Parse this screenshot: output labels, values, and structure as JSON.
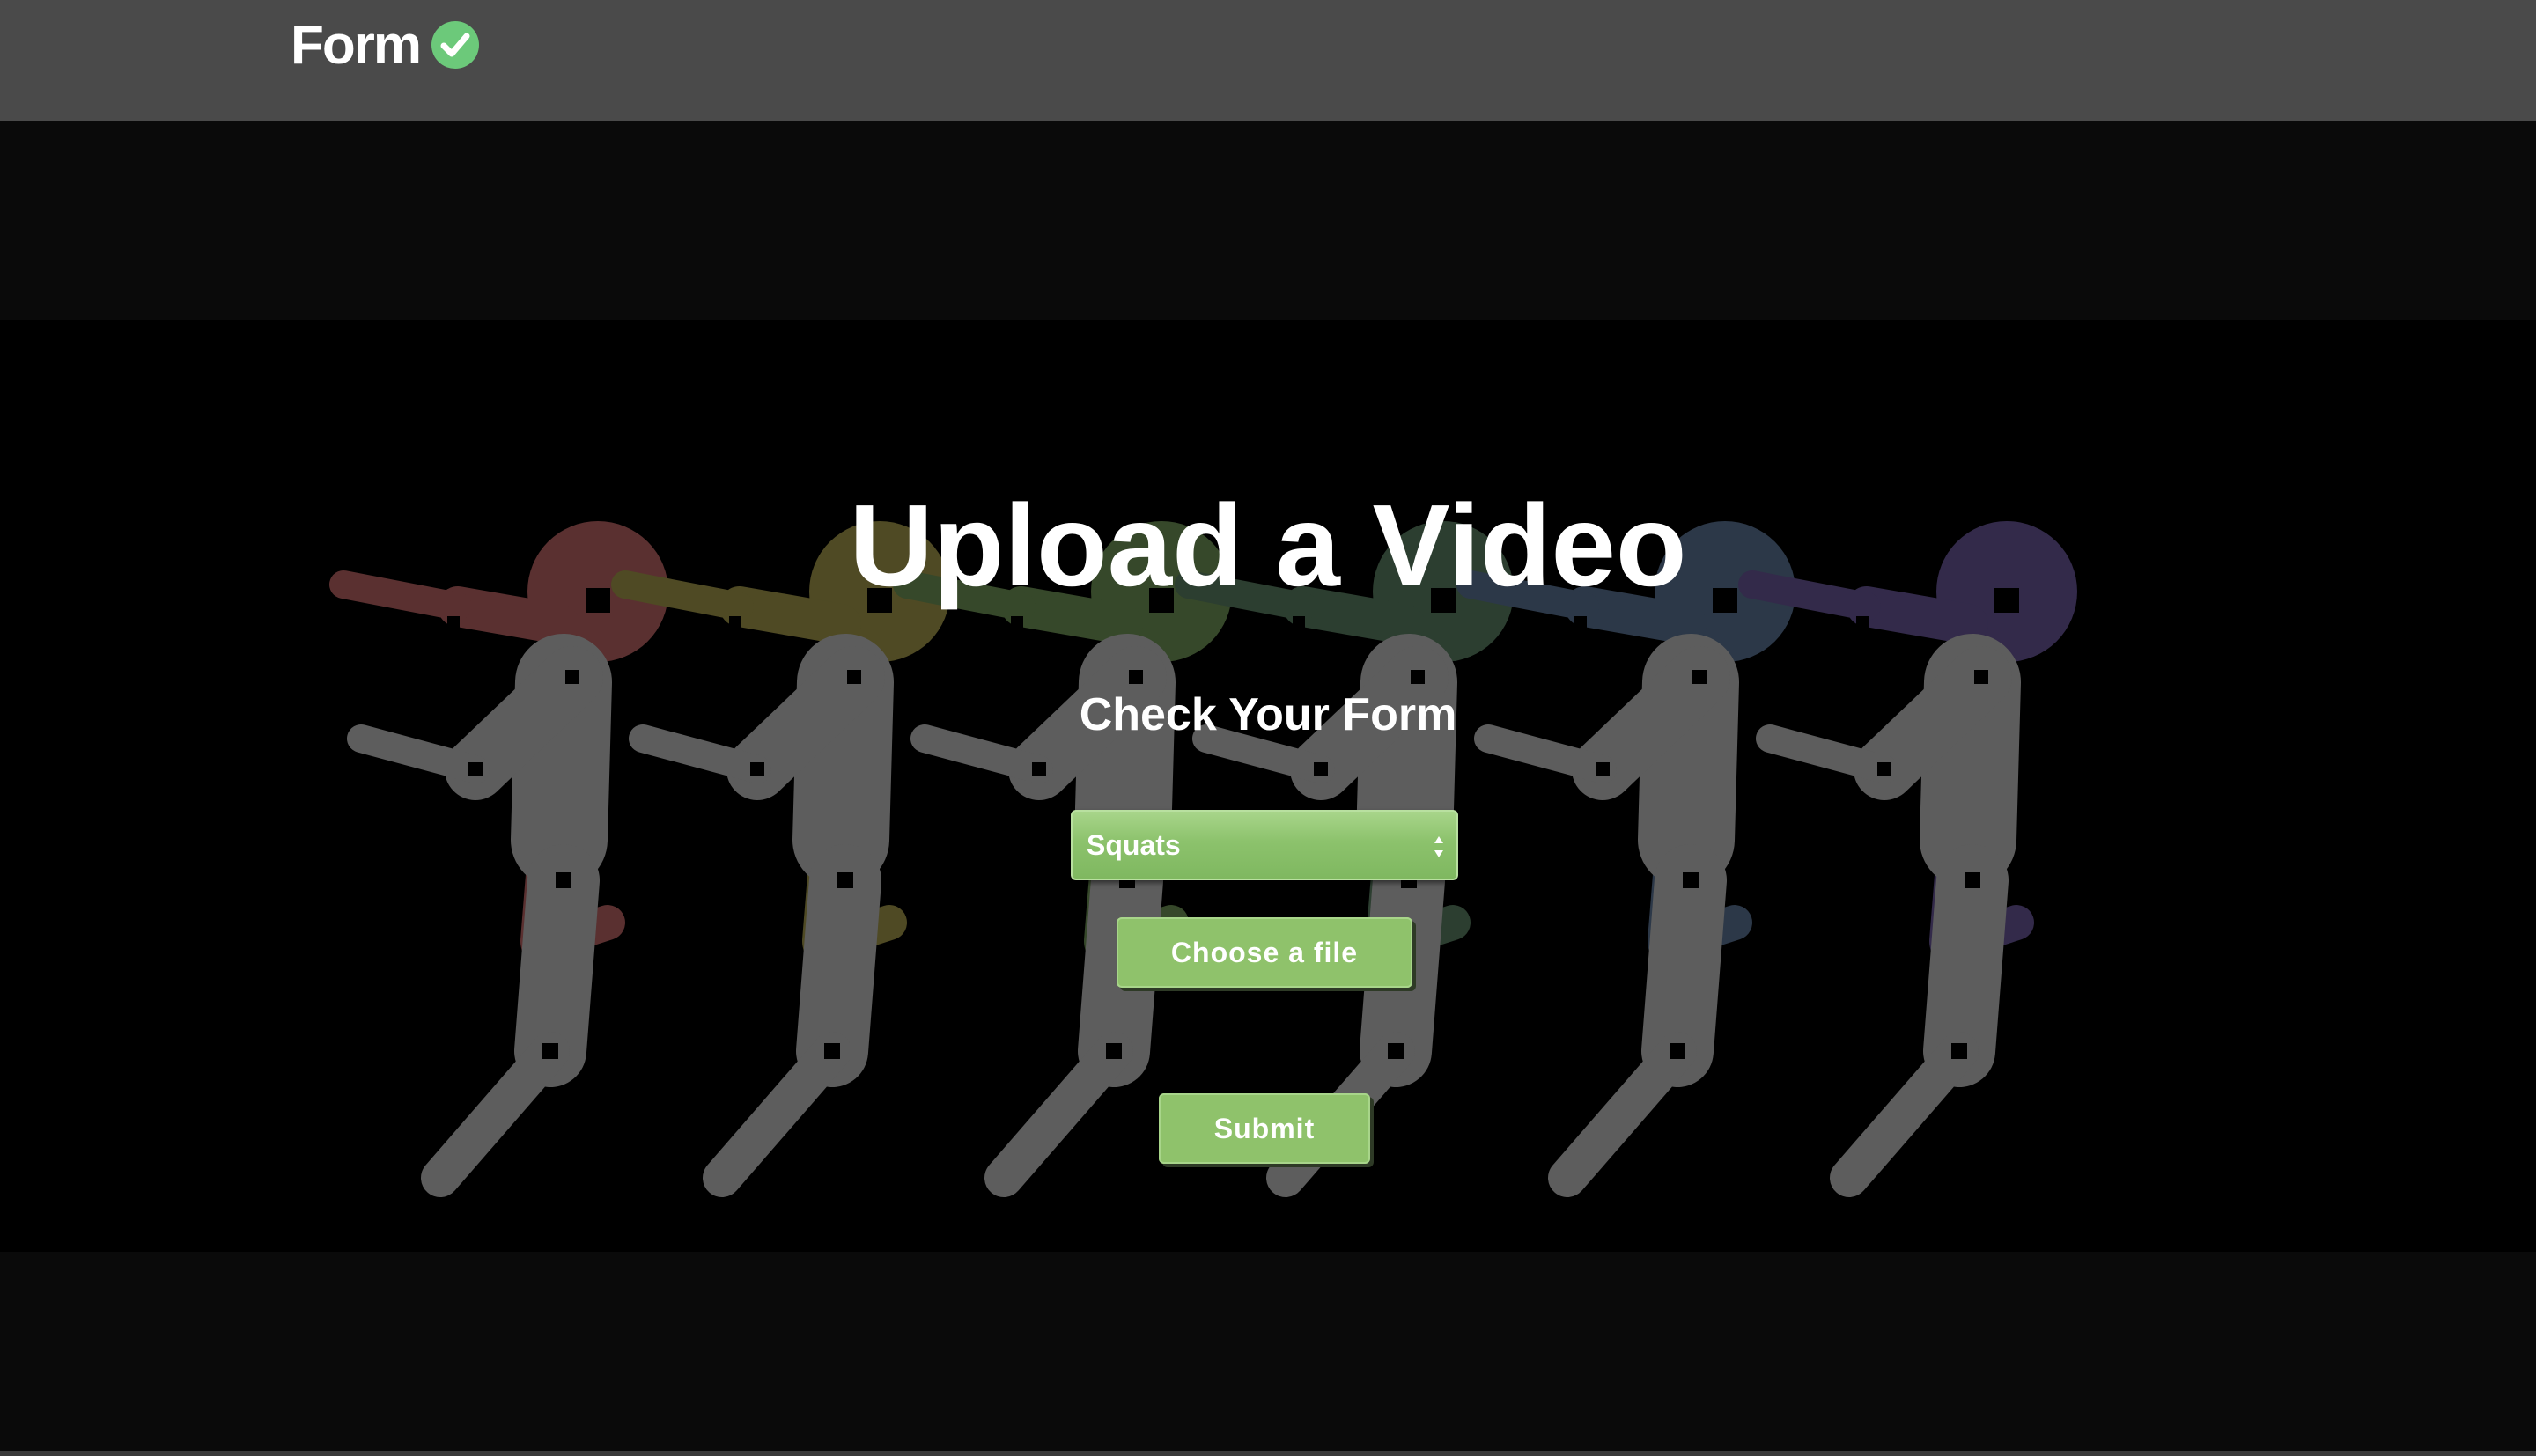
{
  "navbar": {
    "brand_text": "Form",
    "brand_icon": "check-circle-icon",
    "brand_icon_color": "#6cc97a"
  },
  "hero": {
    "title": "Upload a Video",
    "subtitle": "Check Your Form"
  },
  "form": {
    "exercise_select": {
      "selected": "Squats",
      "icon": "updown-arrows-icon"
    },
    "file_button_label": "Choose a file",
    "submit_label": "Submit"
  },
  "colors": {
    "navbar": "#4a4a4a",
    "background": "#000000",
    "accent_green": "#8fc26b",
    "figure_tints": [
      "#5a3030",
      "#4f4a24",
      "#36482a",
      "#2c3e30",
      "#2c3848",
      "#332a4a"
    ]
  }
}
